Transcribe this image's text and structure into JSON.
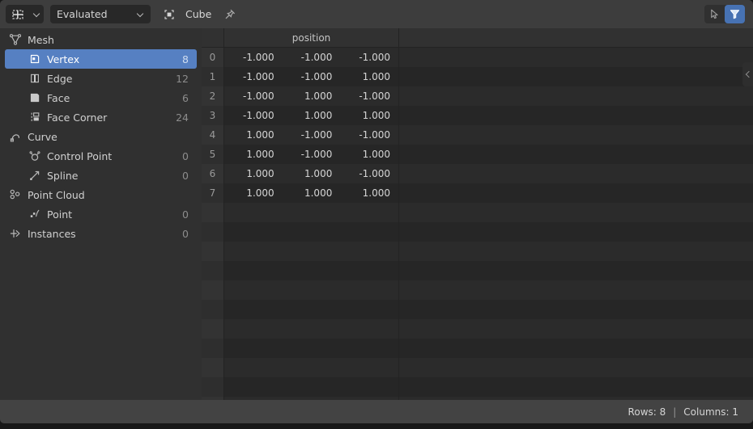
{
  "header": {
    "editor_type_icon": "spreadsheet-editor-icon",
    "editor_type_chevron": "chevron-down-icon",
    "dataset_mode": "Evaluated",
    "dataset_mode_chevron": "chevron-down-icon",
    "object_icon": "object-data-icon",
    "object_name": "Cube",
    "pin_icon": "pin-icon",
    "cursor_icon": "cursor-arrow-icon",
    "filter_icon": "filter-funnel-icon",
    "filter_active_color": "#4772b3"
  },
  "sidebar": {
    "items": [
      {
        "label": "Mesh",
        "count": "",
        "icon": "mesh-data-icon",
        "child": false,
        "selected": false
      },
      {
        "label": "Vertex",
        "count": "8",
        "icon": "vertex-icon",
        "child": true,
        "selected": true
      },
      {
        "label": "Edge",
        "count": "12",
        "icon": "edge-icon",
        "child": true,
        "selected": false
      },
      {
        "label": "Face",
        "count": "6",
        "icon": "face-icon",
        "child": true,
        "selected": false
      },
      {
        "label": "Face Corner",
        "count": "24",
        "icon": "face-corner-icon",
        "child": true,
        "selected": false
      },
      {
        "label": "Curve",
        "count": "",
        "icon": "curve-data-icon",
        "child": false,
        "selected": false
      },
      {
        "label": "Control Point",
        "count": "0",
        "icon": "control-point-icon",
        "child": true,
        "selected": false
      },
      {
        "label": "Spline",
        "count": "0",
        "icon": "spline-icon",
        "child": true,
        "selected": false
      },
      {
        "label": "Point Cloud",
        "count": "",
        "icon": "point-cloud-icon",
        "child": false,
        "selected": false
      },
      {
        "label": "Point",
        "count": "0",
        "icon": "point-icon",
        "child": true,
        "selected": false
      },
      {
        "label": "Instances",
        "count": "0",
        "icon": "instances-icon",
        "child": false,
        "selected": false
      }
    ],
    "selected_color": "#5680c2"
  },
  "table": {
    "index_header": "",
    "column_headers": [
      "position"
    ],
    "rows": [
      {
        "index": "0",
        "position": [
          "-1.000",
          "-1.000",
          "-1.000"
        ]
      },
      {
        "index": "1",
        "position": [
          "-1.000",
          "-1.000",
          "1.000"
        ]
      },
      {
        "index": "2",
        "position": [
          "-1.000",
          "1.000",
          "-1.000"
        ]
      },
      {
        "index": "3",
        "position": [
          "-1.000",
          "1.000",
          "1.000"
        ]
      },
      {
        "index": "4",
        "position": [
          "1.000",
          "-1.000",
          "-1.000"
        ]
      },
      {
        "index": "5",
        "position": [
          "1.000",
          "-1.000",
          "1.000"
        ]
      },
      {
        "index": "6",
        "position": [
          "1.000",
          "1.000",
          "-1.000"
        ]
      },
      {
        "index": "7",
        "position": [
          "1.000",
          "1.000",
          "1.000"
        ]
      }
    ],
    "empty_row_count": 11,
    "collapse_tab_icon": "chevron-left-icon"
  },
  "status": {
    "rows_label": "Rows: 8",
    "separator": "|",
    "columns_label": "Columns: 1"
  }
}
